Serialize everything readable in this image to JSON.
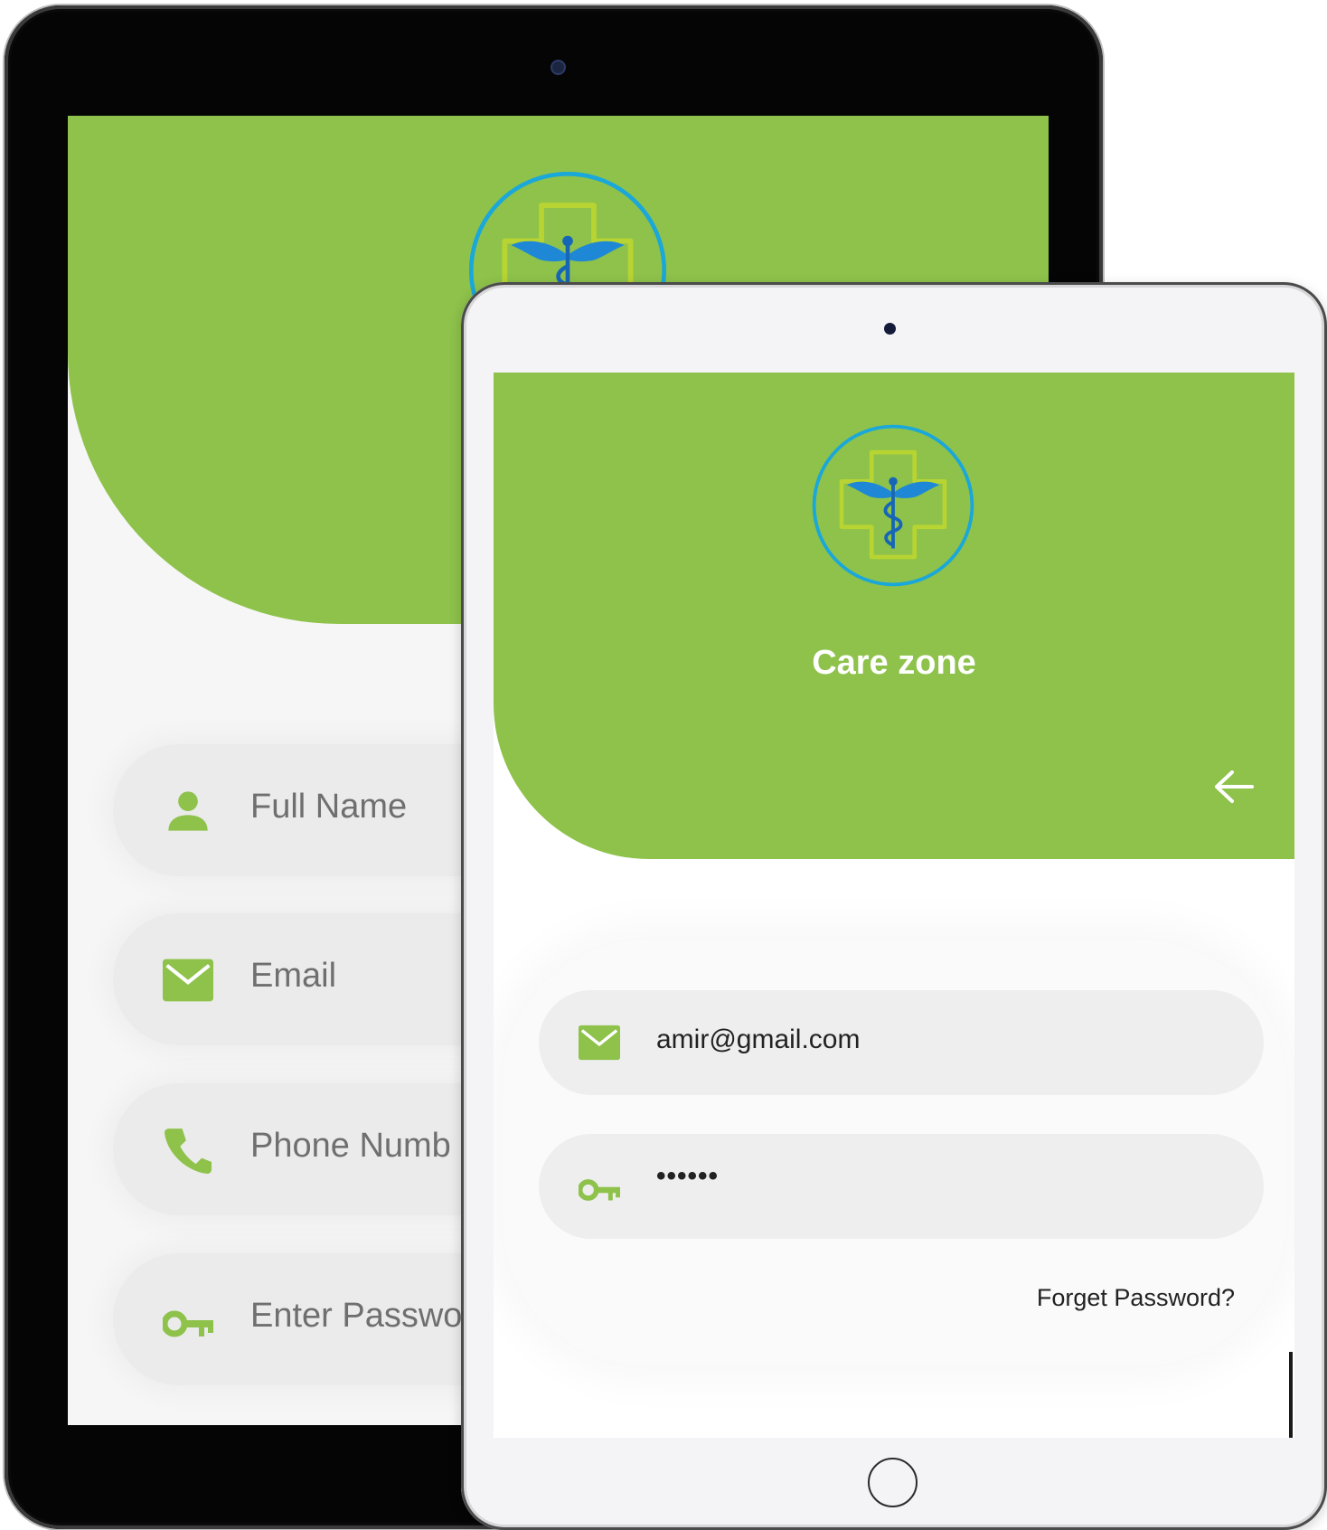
{
  "colors": {
    "header_green": "#8ec24b",
    "field_bg": "#eeeeee",
    "logo_cyan": "#1aa7d9",
    "logo_lime": "#b8d432"
  },
  "icons": {
    "logo": "caduceus-cross-logo",
    "person": "person-icon",
    "email": "envelope-icon",
    "phone": "phone-icon",
    "key": "key-icon",
    "back": "arrow-left-icon"
  },
  "signup_screen": {
    "fields": [
      {
        "label": "Full Name",
        "icon": "person-icon"
      },
      {
        "label": "Email",
        "icon": "envelope-icon"
      },
      {
        "label": "Phone Numb",
        "icon": "phone-icon"
      },
      {
        "label": "Enter Passwo",
        "icon": "key-icon"
      }
    ]
  },
  "login_screen": {
    "title": "Care zone",
    "email_value": "amir@gmail.com",
    "password_value": "••••••",
    "forgot_label": "Forget Password?"
  }
}
